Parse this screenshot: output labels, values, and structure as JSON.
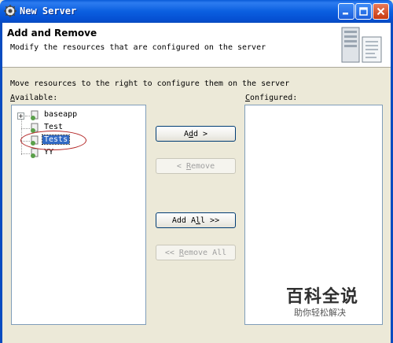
{
  "window": {
    "title": "New Server",
    "minimize_icon": "minimize-icon",
    "maximize_icon": "maximize-icon",
    "close_icon": "close-icon"
  },
  "header": {
    "title": "Add and Remove",
    "description": "Modify the resources that are configured on the server",
    "icon": "server-wizard-icon"
  },
  "instructions": "Move resources to the right to configure them on the server",
  "available": {
    "label_mnemonic": "A",
    "label_rest": "vailable:",
    "items": [
      {
        "label": "baseapp",
        "expandable": true,
        "selected": false
      },
      {
        "label": "Test",
        "expandable": false,
        "selected": false
      },
      {
        "label": "Tests",
        "expandable": false,
        "selected": true
      },
      {
        "label": "YY",
        "expandable": false,
        "selected": false
      }
    ]
  },
  "configured": {
    "label_mnemonic": "C",
    "label_rest": "onfigured:",
    "items": []
  },
  "buttons": {
    "add": {
      "pre": "A",
      "mn": "d",
      "post": "d >",
      "enabled": true
    },
    "remove": {
      "pre": "< ",
      "mn": "R",
      "post": "emove",
      "enabled": false
    },
    "add_all": {
      "pre": "Add A",
      "mn": "l",
      "post": "l >>",
      "enabled": true
    },
    "remove_all": {
      "pre": "<< ",
      "mn": "R",
      "post": "emove All",
      "enabled": false
    }
  },
  "watermark": {
    "big": "百科全说",
    "small": "助你轻松解决"
  },
  "colors": {
    "titlebar": "#0b5fe0",
    "dialog_bg": "#ece9d8",
    "selection": "#316ac5",
    "annotation_oval": "#b22222"
  }
}
